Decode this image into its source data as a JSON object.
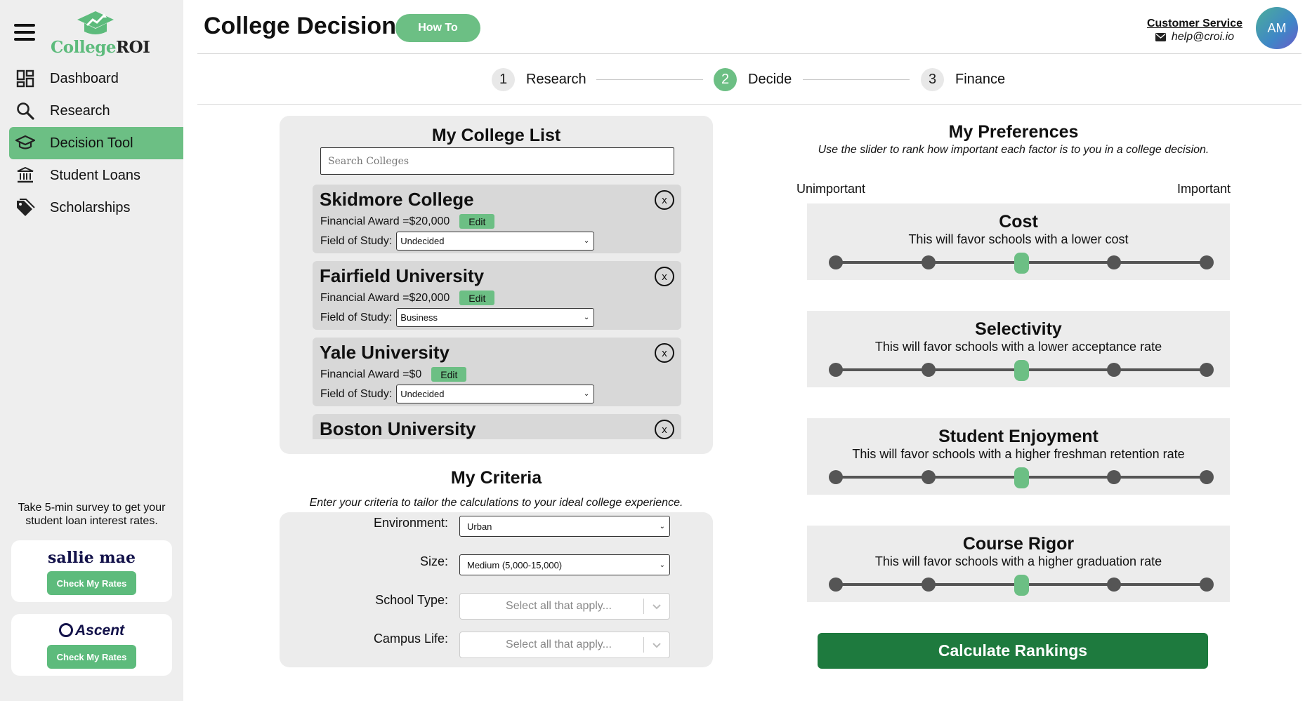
{
  "app": {
    "logo_part1": "College",
    "logo_part2": "ROI"
  },
  "sidebar": {
    "items": [
      {
        "label": "Dashboard",
        "icon": "dashboard-icon",
        "active": false
      },
      {
        "label": "Research",
        "icon": "search-icon",
        "active": false
      },
      {
        "label": "Decision Tool",
        "icon": "graduation-cap-icon",
        "active": true
      },
      {
        "label": "Student Loans",
        "icon": "bank-icon",
        "active": false
      },
      {
        "label": "Scholarships",
        "icon": "tag-icon",
        "active": false
      }
    ],
    "survey_text": "Take 5-min survey to get your student loan interest rates.",
    "lenders": [
      {
        "brand": "sallie mae",
        "button": "Check My Rates"
      },
      {
        "brand": "Ascent",
        "button": "Check My Rates"
      }
    ]
  },
  "header": {
    "title": "College Decision",
    "how_to": "How To",
    "customer_service": "Customer Service",
    "email": "help@croi.io",
    "avatar_initials": "AM"
  },
  "steps": [
    {
      "num": "1",
      "label": "Research",
      "active": false
    },
    {
      "num": "2",
      "label": "Decide",
      "active": true
    },
    {
      "num": "3",
      "label": "Finance",
      "active": false
    }
  ],
  "college_list": {
    "title": "My College List",
    "search_placeholder": "Search Colleges",
    "award_prefix": "Financial Award = ",
    "fos_label": "Field of Study:",
    "edit_label": "Edit",
    "remove_label": "x",
    "colleges": [
      {
        "name": "Skidmore College",
        "award": "$20,000",
        "field": "Undecided"
      },
      {
        "name": "Fairfield University",
        "award": "$20,000",
        "field": "Business"
      },
      {
        "name": "Yale University",
        "award": "$0",
        "field": "Undecided"
      },
      {
        "name": "Boston University",
        "award": "",
        "field": ""
      }
    ]
  },
  "criteria": {
    "title": "My Criteria",
    "subtitle": "Enter your criteria to tailor the calculations to your ideal college experience.",
    "environment_label": "Environment:",
    "environment_value": "Urban",
    "size_label": "Size:",
    "size_value": "Medium (5,000-15,000)",
    "school_type_label": "School Type:",
    "school_type_placeholder": "Select all that apply...",
    "campus_life_label": "Campus Life:",
    "campus_life_placeholder": "Select all that apply..."
  },
  "preferences": {
    "title": "My Preferences",
    "subtitle": "Use the slider to rank how important each factor is to you in a college decision.",
    "scale_low": "Unimportant",
    "scale_high": "Important",
    "levels": 5,
    "factors": [
      {
        "name": "Cost",
        "desc": "This will favor schools with a lower cost",
        "value": 3
      },
      {
        "name": "Selectivity",
        "desc": "This will favor schools with a lower acceptance rate",
        "value": 3
      },
      {
        "name": "Student Enjoyment",
        "desc": "This will favor schools with a higher freshman retention rate",
        "value": 3
      },
      {
        "name": "Course Rigor",
        "desc": "This will favor schools with a higher graduation rate",
        "value": 3
      }
    ],
    "calculate": "Calculate Rankings"
  },
  "colors": {
    "accent": "#6cbf84",
    "primary_dark": "#1e7a3e",
    "panel": "#ececec",
    "sidebar": "#eeeeee"
  }
}
